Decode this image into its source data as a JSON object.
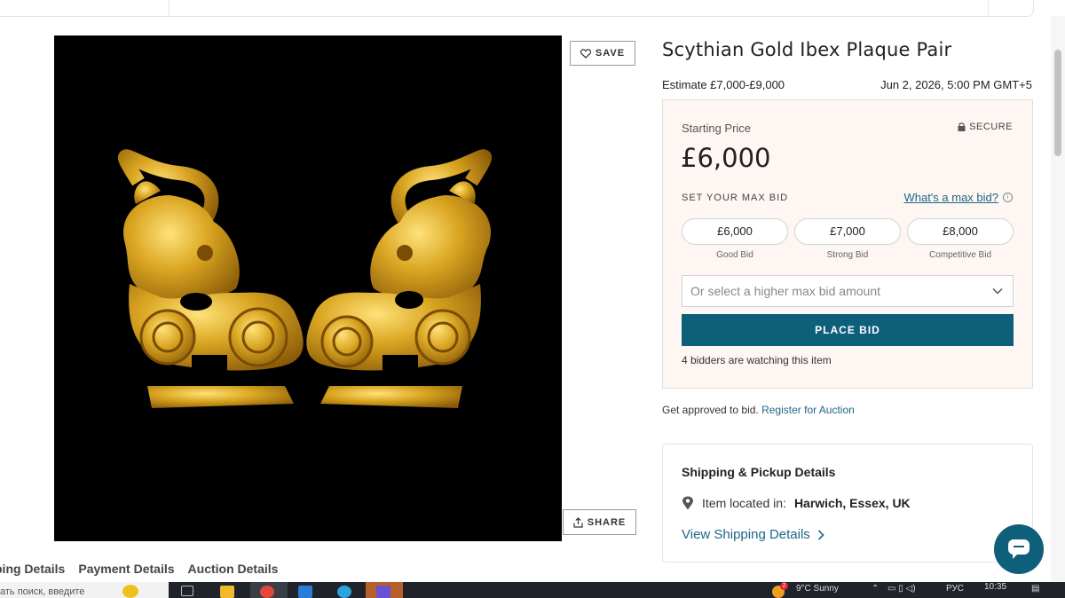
{
  "lot": {
    "title": "Scythian Gold Ibex Plaque Pair",
    "estimate": "Estimate £7,000-£9,000",
    "date": "Jun 2, 2026, 5:00 PM GMT+5",
    "save_label": "SAVE",
    "share_label": "SHARE"
  },
  "bid": {
    "starting_label": "Starting Price",
    "secure_label": "SECURE",
    "starting_price": "£6,000",
    "maxbid_label": "SET YOUR MAX BID",
    "maxbid_link": "What's a max bid?",
    "options": [
      {
        "amount": "£6,000",
        "label": "Good Bid"
      },
      {
        "amount": "£7,000",
        "label": "Strong Bid"
      },
      {
        "amount": "£8,000",
        "label": "Competitive Bid"
      }
    ],
    "select_placeholder": "Or select a higher max bid amount",
    "place_bid_label": "PLACE BID",
    "watchers": "4 bidders are watching this item"
  },
  "approval": {
    "text": "Get approved to bid.",
    "link": "Register for Auction"
  },
  "shipping": {
    "title": "Shipping & Pickup Details",
    "located_label": "Item located in:",
    "location": "Harwich, Essex, UK",
    "link": "View Shipping Details"
  },
  "tabs": [
    "ping Details",
    "Payment Details",
    "Auction Details"
  ],
  "taskbar": {
    "search_text": "ать поиск, введите",
    "weather": "9°C  Sunny",
    "lang": "РУС",
    "time": "10:35",
    "notification_count": "2"
  },
  "icons": {
    "save": "heart-icon",
    "share": "share-icon",
    "secure": "lock-icon",
    "info": "info-icon",
    "select": "chevron-down-icon",
    "location": "map-pin-icon",
    "link": "chevron-right-icon",
    "chat": "chat-bubble-icon"
  },
  "colors": {
    "accent": "#0e5f7a",
    "link": "#1e6688",
    "panel": "#fdf6f2",
    "gold": "#d9a521"
  }
}
